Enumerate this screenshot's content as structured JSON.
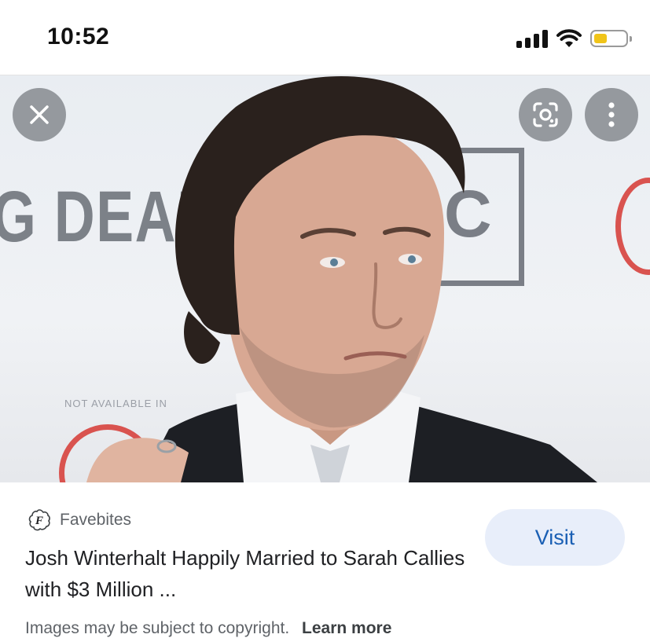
{
  "status_bar": {
    "time": "10:52",
    "icons": [
      "cellular-signal-icon",
      "wifi-icon",
      "battery-icon"
    ],
    "battery_color": "#f0c419"
  },
  "image_viewer": {
    "close_icon": "close-icon",
    "lens_icon": "lens-icon",
    "more_icon": "more-vertical-icon",
    "backdrop_text_left": "G DEAD",
    "backdrop_text_box": "C",
    "backdrop_text_bottom": "G DEA",
    "backdrop_small_text": "NOT AVAILABLE IN"
  },
  "result": {
    "source_name": "Favebites",
    "source_logo_letter": "F",
    "title": "Josh Winterhalt Happily Married to Sarah Callies with $3 Million ...",
    "visit_label": "Visit",
    "copyright_text": "Images may be subject to copyright.",
    "learn_more_label": "Learn more",
    "accent_color": "#1a5fb4"
  }
}
